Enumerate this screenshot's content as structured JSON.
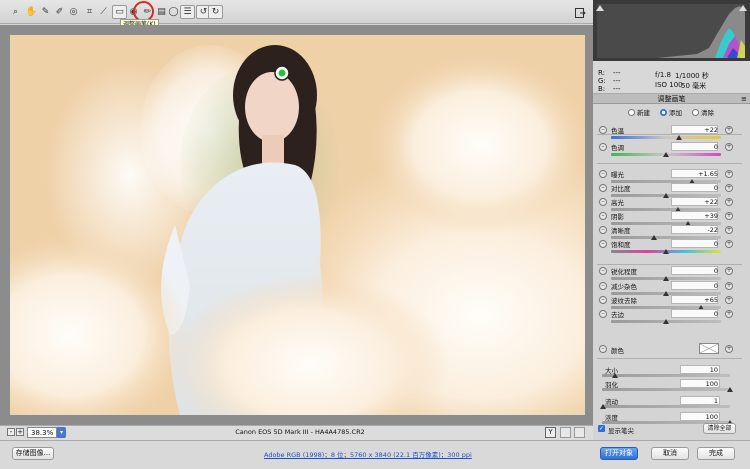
{
  "toolbar": {
    "tools": [
      "zoom-icon",
      "hand-icon",
      "white-balance-icon",
      "color-sampler-icon",
      "targeted-adjust-icon",
      "crop-icon",
      "straighten-icon",
      "spot-removal-icon",
      "red-eye-icon",
      "adjustment-brush-icon",
      "graduated-filter-icon",
      "radial-filter-icon",
      "preferences-icon",
      "rotate-left-icon",
      "rotate-right-icon"
    ],
    "tooltip": "调整画笔(K)",
    "fullscreen_icon": "fullscreen-icon"
  },
  "info": {
    "r_label": "R:",
    "g_label": "G:",
    "b_label": "B:",
    "r_val": "---",
    "g_val": "---",
    "b_val": "---",
    "aperture": "f/1.8",
    "shutter": "1/1000 秒",
    "iso": "ISO 100",
    "focal": "50 毫米"
  },
  "panel": {
    "title": "调整画笔",
    "modes": [
      "新建",
      "添加",
      "清除"
    ],
    "selected_mode": "添加",
    "sliders": [
      {
        "label": "色温",
        "value": "+22",
        "pos": 0.62,
        "track": "temp"
      },
      {
        "label": "色调",
        "value": "0",
        "pos": 0.5,
        "track": "tint"
      },
      {
        "label": "曝光",
        "value": "+1.65",
        "pos": 0.74,
        "track": "gray"
      },
      {
        "label": "对比度",
        "value": "0",
        "pos": 0.5,
        "track": "gray"
      },
      {
        "label": "高光",
        "value": "+22",
        "pos": 0.61,
        "track": "gray"
      },
      {
        "label": "阴影",
        "value": "+39",
        "pos": 0.7,
        "track": "gray"
      },
      {
        "label": "清晰度",
        "value": "-22",
        "pos": 0.39,
        "track": "gray"
      },
      {
        "label": "饱和度",
        "value": "0",
        "pos": 0.5,
        "track": "sat"
      },
      {
        "label": "锐化程度",
        "value": "0",
        "pos": 0.5,
        "track": "gray"
      },
      {
        "label": "减少杂色",
        "value": "0",
        "pos": 0.5,
        "track": "gray"
      },
      {
        "label": "波纹去除",
        "value": "+65",
        "pos": 0.82,
        "track": "gray"
      },
      {
        "label": "去边",
        "value": "0",
        "pos": 0.5,
        "track": "gray"
      }
    ],
    "color_label": "颜色",
    "brush": [
      {
        "label": "大小",
        "value": "10",
        "pos": 0.1
      },
      {
        "label": "羽化",
        "value": "100",
        "pos": 1.0
      },
      {
        "label": "流动",
        "value": "1",
        "pos": 0.01
      },
      {
        "label": "浓度",
        "value": "100",
        "pos": 1.0
      }
    ],
    "show_mask_label": "显示笔尖",
    "show_mask_checked": true,
    "clear_all_label": "清除全部"
  },
  "canvas": {
    "zoom": "38.3%",
    "camera": "Canon EOS 5D Mark III - ",
    "filename": "HA4A4785.CR2"
  },
  "bottom": {
    "save_label": "存储图像...",
    "workflow": "Adobe RGB (1998)；8 位；5760 x 3840 (22.1 百万像素)；300 ppi",
    "open_label": "打开对象",
    "cancel_label": "取消",
    "done_label": "完成"
  },
  "colors": {
    "accent": "#2f6fd6",
    "link": "#1a4fd0",
    "tooltip_bg": "#ffffc8",
    "highlight_circle": "#d62a2a"
  }
}
